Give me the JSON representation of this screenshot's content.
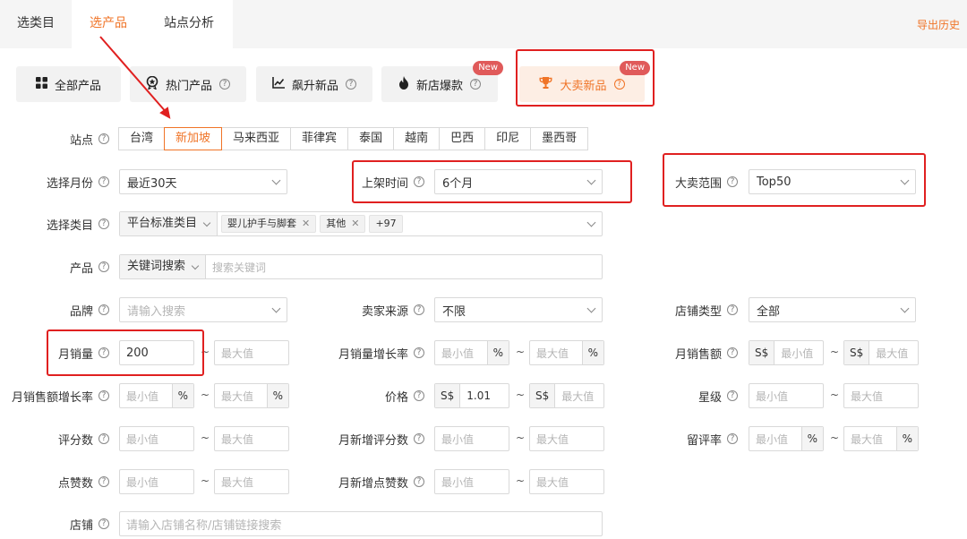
{
  "tabs": [
    {
      "label": "选类目"
    },
    {
      "label": "选产品"
    },
    {
      "label": "站点分析"
    }
  ],
  "export_history": "导出历史",
  "product_types": [
    {
      "label": "全部产品",
      "icon": "grid-icon"
    },
    {
      "label": "热门产品",
      "icon": "medal-icon"
    },
    {
      "label": "飙升新品",
      "icon": "line-chart-icon"
    },
    {
      "label": "新店爆款",
      "icon": "flame-icon"
    },
    {
      "label": "大卖新品",
      "icon": "trophy-icon"
    }
  ],
  "new_badge": "New",
  "help": "?",
  "tilde": "~",
  "site": {
    "label": "站点",
    "options": [
      "台湾",
      "新加坡",
      "马来西亚",
      "菲律宾",
      "泰国",
      "越南",
      "巴西",
      "印尼",
      "墨西哥"
    ],
    "selected": "新加坡"
  },
  "month": {
    "label": "选择月份",
    "value": "最近30天"
  },
  "listing_time": {
    "label": "上架时间",
    "value": "6个月"
  },
  "top_range": {
    "label": "大卖范围",
    "value": "Top50"
  },
  "category": {
    "label": "选择类目",
    "mode": "平台标准类目",
    "tags": [
      "婴儿护手与脚套",
      "其他"
    ],
    "more": "+97"
  },
  "product": {
    "label": "产品",
    "mode": "关键词搜索",
    "placeholder": "搜索关键词"
  },
  "brand": {
    "label": "品牌",
    "placeholder": "请输入搜索"
  },
  "seller_source": {
    "label": "卖家来源",
    "value": "不限"
  },
  "shop_type": {
    "label": "店铺类型",
    "value": "全部"
  },
  "monthly_sales": {
    "label": "月销量",
    "min": "200",
    "max_placeholder": "最大值"
  },
  "sales_growth": {
    "label": "月销量增长率"
  },
  "monthly_revenue": {
    "label": "月销售额"
  },
  "revenue_growth": {
    "label": "月销售额增长率"
  },
  "price": {
    "label": "价格",
    "min": "1.01"
  },
  "rating": {
    "label": "星级"
  },
  "reviews": {
    "label": "评分数"
  },
  "new_reviews": {
    "label": "月新增评分数"
  },
  "retention": {
    "label": "留评率"
  },
  "likes": {
    "label": "点赞数"
  },
  "new_likes": {
    "label": "月新增点赞数"
  },
  "shop": {
    "label": "店铺",
    "placeholder": "请输入店铺名称/店铺链接搜索"
  },
  "min_placeholder": "最小值",
  "max_placeholder": "最大值",
  "currency": "S$",
  "percent": "%",
  "colors": {
    "accent": "#f07427",
    "annotation": "#e02020",
    "badge": "#e05a5a"
  }
}
